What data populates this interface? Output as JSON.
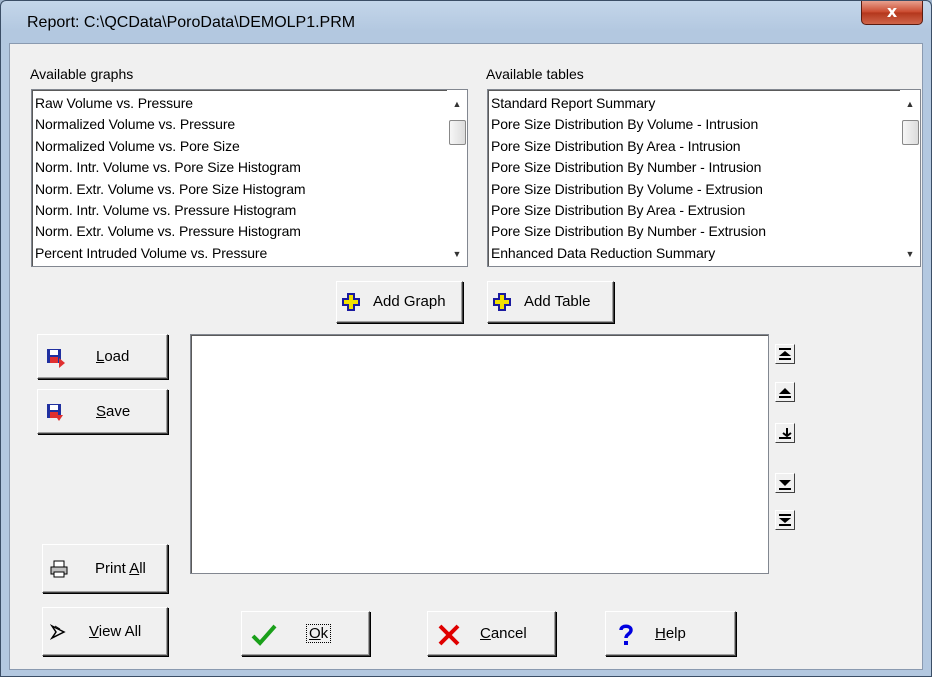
{
  "window": {
    "title": "Report: C:\\QCData\\PoroData\\DEMOLP1.PRM",
    "close_glyph": "x"
  },
  "available_graphs": {
    "label": "Available graphs",
    "items": [
      "Raw Volume vs. Pressure",
      "Normalized Volume vs. Pressure",
      "Normalized Volume vs. Pore Size",
      "Norm. Intr. Volume vs. Pore Size Histogram",
      "Norm. Extr. Volume vs. Pore Size Histogram",
      "Norm. Intr. Volume vs. Pressure Histogram",
      "Norm. Extr. Volume vs. Pressure Histogram",
      "Percent Intruded Volume vs. Pressure"
    ]
  },
  "available_tables": {
    "label": "Available tables",
    "items": [
      "Standard Report Summary",
      "Pore Size Distribution By Volume - Intrusion",
      "Pore Size Distribution By Area - Intrusion",
      "Pore Size Distribution By Number - Intrusion",
      "Pore Size Distribution By Volume - Extrusion",
      "Pore Size Distribution By Area - Extrusion",
      "Pore Size Distribution By Number - Extrusion",
      "Enhanced Data Reduction Summary"
    ]
  },
  "buttons": {
    "add_graph": "Add Graph",
    "add_table": "Add Table",
    "load": {
      "prefix": "",
      "mnemonic": "L",
      "rest": "oad"
    },
    "save": {
      "prefix": "",
      "mnemonic": "S",
      "rest": "ave"
    },
    "print_all": {
      "prefix": "Print ",
      "mnemonic": "A",
      "rest": "ll"
    },
    "view_all": {
      "prefix": "",
      "mnemonic": "V",
      "rest": "iew All"
    },
    "ok": {
      "prefix": "",
      "mnemonic": "O",
      "rest": "k"
    },
    "cancel": {
      "prefix": "",
      "mnemonic": "C",
      "rest": "ancel"
    },
    "help": {
      "prefix": "",
      "mnemonic": "H",
      "rest": "elp"
    }
  },
  "colors": {
    "add_icon_fill": "#f2e200",
    "add_icon_stroke": "#1a1aa0",
    "ok_check": "#1aa01a",
    "cancel_x": "#e00000",
    "help_q": "#0000e0"
  },
  "icons": {
    "add_graph": "plus-icon",
    "add_table": "plus-icon",
    "load": "floppy-load-icon",
    "save": "floppy-save-icon",
    "print_all": "printer-icon",
    "view_all": "view-arrow-icon",
    "ok": "checkmark-icon",
    "cancel": "x-icon",
    "help": "question-icon",
    "move_top": "move-to-top-icon",
    "move_up": "move-up-icon",
    "insert": "insert-icon",
    "move_down": "move-down-icon",
    "move_bottom": "move-to-bottom-icon"
  }
}
